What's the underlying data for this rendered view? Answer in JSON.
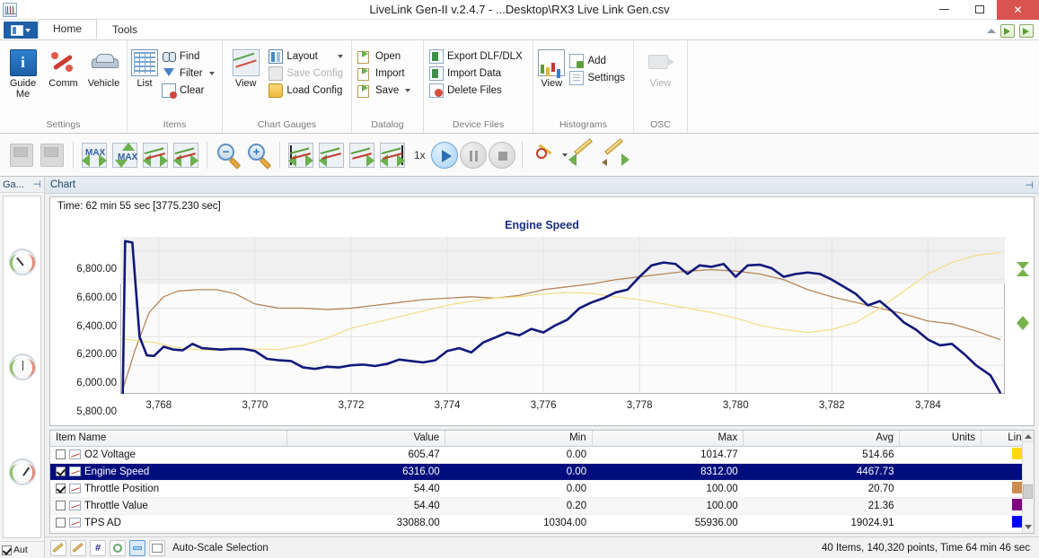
{
  "window": {
    "title": "LiveLink Gen-II  v.2.4.7 - ...Desktop\\RX3 Live Link Gen.csv",
    "minimize": "–",
    "maximize": "□",
    "close": "✕"
  },
  "ribbon": {
    "tabs": [
      {
        "label": "Home",
        "active": true
      },
      {
        "label": "Tools",
        "active": false
      }
    ],
    "groups": [
      {
        "title": "Settings",
        "big": [
          {
            "label": "Guide\nMe",
            "icon": "guide-me-icon"
          },
          {
            "label": "Comm",
            "icon": "comm-icon"
          },
          {
            "label": "Vehicle",
            "icon": "vehicle-icon"
          }
        ],
        "small": []
      },
      {
        "title": "Items",
        "big": [
          {
            "label": "List",
            "icon": "list-icon"
          }
        ],
        "small": [
          {
            "label": "Find",
            "icon": "find-icon",
            "disabled": false,
            "caret": false
          },
          {
            "label": "Filter",
            "icon": "filter-icon",
            "disabled": false,
            "caret": true
          },
          {
            "label": "Clear",
            "icon": "clear-icon",
            "disabled": false,
            "caret": false
          }
        ]
      },
      {
        "title": "Chart  Gauges",
        "big": [
          {
            "label": "View",
            "icon": "chart-view-icon"
          }
        ],
        "small": [
          {
            "label": "Layout",
            "icon": "layout-icon",
            "disabled": false,
            "caret": true
          },
          {
            "label": "Save Config",
            "icon": "save-config-icon",
            "disabled": true,
            "caret": false
          },
          {
            "label": "Load Config",
            "icon": "load-config-icon",
            "disabled": false,
            "caret": false
          }
        ]
      },
      {
        "title": "Datalog",
        "big": [],
        "small": [
          {
            "label": "Open",
            "icon": "open-icon",
            "disabled": false,
            "caret": false
          },
          {
            "label": "Import",
            "icon": "import-icon",
            "disabled": false,
            "caret": false
          },
          {
            "label": "Save",
            "icon": "save-icon",
            "disabled": false,
            "caret": true
          }
        ]
      },
      {
        "title": "Device Files",
        "big": [],
        "small": [
          {
            "label": "Export DLF/DLX",
            "icon": "export-dlf-icon",
            "disabled": false,
            "caret": false
          },
          {
            "label": "Import Data",
            "icon": "import-data-icon",
            "disabled": false,
            "caret": false
          },
          {
            "label": "Delete Files",
            "icon": "delete-files-icon",
            "disabled": false,
            "caret": false
          }
        ]
      },
      {
        "title": "Histograms",
        "big": [
          {
            "label": "View",
            "icon": "histogram-view-icon"
          }
        ],
        "small": [
          {
            "label": "Add",
            "icon": "add-icon",
            "disabled": false,
            "caret": false
          },
          {
            "label": "Settings",
            "icon": "settings-icon",
            "disabled": false,
            "caret": false
          }
        ]
      },
      {
        "title": "OSC",
        "big": [
          {
            "label": "View",
            "icon": "osc-view-icon",
            "disabled": true
          }
        ],
        "small": []
      }
    ]
  },
  "toolbar": {
    "speed_label": "1x",
    "buttons": [
      "record-disabled-icon",
      "record-stop-disabled-icon",
      "max-left-right-icon",
      "max-updown-icon",
      "scroll-left-right-icon",
      "scroll-data-icon",
      "zoom-out-icon",
      "zoom-in-icon",
      "goto-start-icon",
      "step-back-icon",
      "step-forward-icon",
      "goto-end-icon",
      "play-button",
      "pause-button",
      "stop-button",
      "marker-icon",
      "pencil-left-icon",
      "pencil-right-icon"
    ]
  },
  "gauges_panel": {
    "title": "Ga...",
    "pin": "⊣",
    "auto_label": "Aut",
    "auto_checked": true,
    "gauges": 3
  },
  "chart_panel": {
    "header": "Chart",
    "pin": "⊣",
    "time_text": "Time: 62 min 55 sec [3775.230 sec]"
  },
  "chart_data": {
    "type": "line",
    "title": "Engine Speed",
    "xlabel": "",
    "ylabel": "",
    "grid": true,
    "legend_position": "none",
    "ylim": [
      5800,
      6900
    ],
    "yticks": [
      5800,
      6000,
      6200,
      6400,
      6600,
      6800
    ],
    "ytick_labels": [
      "5,800.00",
      "6,000.00",
      "6,200.00",
      "6,400.00",
      "6,600.00",
      "6,800.00"
    ],
    "xlim": [
      3767.2,
      3785.6
    ],
    "xticks": [
      3768,
      3770,
      3772,
      3774,
      3776,
      3778,
      3780,
      3782,
      3784
    ],
    "xtick_labels": [
      "3,768",
      "3,770",
      "3,772",
      "3,774",
      "3,776",
      "3,778",
      "3,780",
      "3,782",
      "3,784"
    ],
    "series": [
      {
        "name": "Engine Speed",
        "color": "#10197a",
        "width": 2.6,
        "x": [
          3767.25,
          3767.3,
          3767.45,
          3767.6,
          3767.75,
          3767.9,
          3768.1,
          3768.3,
          3768.5,
          3768.7,
          3768.9,
          3769.1,
          3769.3,
          3769.5,
          3769.75,
          3770.0,
          3770.25,
          3770.5,
          3770.75,
          3771.0,
          3771.25,
          3771.5,
          3771.75,
          3772.0,
          3772.25,
          3772.5,
          3772.75,
          3773.0,
          3773.25,
          3773.5,
          3773.75,
          3774.0,
          3774.25,
          3774.5,
          3774.75,
          3775.0,
          3775.25,
          3775.5,
          3775.75,
          3776.0,
          3776.25,
          3776.5,
          3776.75,
          3777.0,
          3777.25,
          3777.5,
          3777.75,
          3778.0,
          3778.25,
          3778.5,
          3778.75,
          3779.0,
          3779.25,
          3779.5,
          3779.75,
          3780.0,
          3780.25,
          3780.5,
          3780.75,
          3781.0,
          3781.25,
          3781.5,
          3781.75,
          3782.0,
          3782.25,
          3782.5,
          3782.75,
          3783.0,
          3783.25,
          3783.5,
          3783.75,
          3784.0,
          3784.25,
          3784.5,
          3784.75,
          3785.0,
          3785.3,
          3785.5
        ],
        "y": [
          5800,
          6870,
          6860,
          6200,
          6070,
          6065,
          6130,
          6110,
          6105,
          6150,
          6120,
          6115,
          6110,
          6115,
          6115,
          6100,
          6045,
          6035,
          6030,
          5985,
          5975,
          5990,
          5985,
          6000,
          6005,
          5995,
          6010,
          6040,
          6030,
          6020,
          6035,
          6100,
          6120,
          6090,
          6160,
          6195,
          6230,
          6210,
          6255,
          6230,
          6280,
          6320,
          6400,
          6440,
          6470,
          6510,
          6530,
          6620,
          6700,
          6720,
          6710,
          6640,
          6700,
          6690,
          6710,
          6620,
          6700,
          6705,
          6680,
          6620,
          6640,
          6650,
          6640,
          6600,
          6550,
          6500,
          6420,
          6450,
          6380,
          6300,
          6250,
          6180,
          6140,
          6150,
          6080,
          6000,
          5930,
          5810
        ]
      },
      {
        "name": "O2 Voltage",
        "color": "#f2e08c",
        "width": 1.3,
        "x": [
          3767.25,
          3767.5,
          3767.9,
          3768.3,
          3768.7,
          3769.1,
          3769.5,
          3770.0,
          3770.5,
          3771.0,
          3771.5,
          3772.0,
          3772.5,
          3773.0,
          3773.5,
          3774.0,
          3774.5,
          3775.0,
          3775.5,
          3776.0,
          3776.5,
          3777.0,
          3777.5,
          3778.0,
          3778.5,
          3779.0,
          3779.5,
          3780.0,
          3780.5,
          3781.0,
          3781.5,
          3782.0,
          3782.5,
          3783.0,
          3783.5,
          3784.0,
          3784.5,
          3785.0,
          3785.5
        ],
        "y": [
          6185,
          6175,
          6160,
          6130,
          6110,
          6105,
          6110,
          6115,
          6110,
          6140,
          6190,
          6260,
          6300,
          6340,
          6380,
          6420,
          6450,
          6470,
          6480,
          6500,
          6510,
          6505,
          6480,
          6460,
          6430,
          6400,
          6370,
          6330,
          6280,
          6250,
          6230,
          6250,
          6300,
          6400,
          6520,
          6640,
          6720,
          6770,
          6790
        ]
      },
      {
        "name": "Throttle Position",
        "color": "#b5855a",
        "width": 1.3,
        "x": [
          3767.25,
          3767.5,
          3767.8,
          3768.1,
          3768.4,
          3768.8,
          3769.2,
          3769.6,
          3770.0,
          3770.5,
          3771.0,
          3771.5,
          3772.0,
          3772.5,
          3773.0,
          3773.5,
          3774.0,
          3774.5,
          3775.0,
          3775.5,
          3776.0,
          3776.5,
          3777.0,
          3777.5,
          3778.0,
          3778.5,
          3779.0,
          3779.5,
          3780.0,
          3780.5,
          3781.0,
          3781.5,
          3782.0,
          3782.5,
          3783.0,
          3783.5,
          3784.0,
          3784.5,
          3785.0,
          3785.5
        ],
        "y": [
          5830,
          6100,
          6370,
          6480,
          6520,
          6530,
          6530,
          6500,
          6430,
          6400,
          6400,
          6390,
          6400,
          6420,
          6440,
          6460,
          6470,
          6480,
          6470,
          6490,
          6530,
          6550,
          6570,
          6600,
          6620,
          6640,
          6660,
          6670,
          6660,
          6640,
          6600,
          6530,
          6480,
          6440,
          6400,
          6360,
          6310,
          6290,
          6240,
          6180
        ]
      }
    ]
  },
  "items_table": {
    "columns": [
      {
        "key": "name",
        "label": "Item Name",
        "align": "left"
      },
      {
        "key": "value",
        "label": "Value",
        "align": "right"
      },
      {
        "key": "min",
        "label": "Min",
        "align": "right"
      },
      {
        "key": "max",
        "label": "Max",
        "align": "right"
      },
      {
        "key": "avg",
        "label": "Avg",
        "align": "right"
      },
      {
        "key": "units",
        "label": "Units",
        "align": "right"
      },
      {
        "key": "line",
        "label": "Line",
        "align": "right"
      }
    ],
    "rows": [
      {
        "checked": false,
        "name": "O2 Voltage",
        "value": "605.47",
        "min": "0.00",
        "max": "1014.77",
        "avg": "514.66",
        "units": "",
        "color": "#ffd90a",
        "selected": false
      },
      {
        "checked": true,
        "name": "Engine Speed",
        "value": "6316.00",
        "min": "0.00",
        "max": "8312.00",
        "avg": "4467.73",
        "units": "",
        "color": "#000e7d",
        "selected": true
      },
      {
        "checked": true,
        "name": "Throttle Position",
        "value": "54.40",
        "min": "0.00",
        "max": "100.00",
        "avg": "20.70",
        "units": "",
        "color": "#cc8c4f",
        "selected": false
      },
      {
        "checked": false,
        "name": "Throttle Value",
        "value": "54.40",
        "min": "0.20",
        "max": "100.00",
        "avg": "21.36",
        "units": "",
        "color": "#800080",
        "selected": false
      },
      {
        "checked": false,
        "name": "TPS AD",
        "value": "33088.00",
        "min": "10304.00",
        "max": "55936.00",
        "avg": "19024.91",
        "units": "",
        "color": "#0000ff",
        "selected": false
      }
    ]
  },
  "statusbar": {
    "selection_label": "Auto-Scale Selection",
    "summary": "40 Items, 140,320 points, Time 64 min 46 sec",
    "buttons": [
      "cursor-a-icon",
      "cursor-b-icon",
      "hash-icon",
      "circle-icon",
      "autoscale-icon",
      "autoscale-selection-icon"
    ]
  }
}
